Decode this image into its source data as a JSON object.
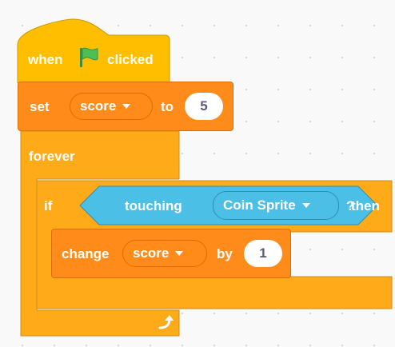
{
  "colors": {
    "events": "#ffbf00",
    "control": "#ffab19",
    "variables": "#ff8c1a",
    "sensing": "#4cbfe6",
    "flag": "#4cbf56"
  },
  "hat_block": {
    "when": "when",
    "icon": "green-flag-icon",
    "clicked": "clicked"
  },
  "set_block": {
    "label": "set",
    "variable": "score",
    "to": "to",
    "value": "5"
  },
  "forever_block": {
    "label": "forever",
    "icon": "loop-arrow-icon"
  },
  "if_block": {
    "label": "if",
    "condition": {
      "label": "touching",
      "target": "Coin Sprite",
      "question": "?"
    },
    "then": "then"
  },
  "change_block": {
    "label": "change",
    "variable": "score",
    "by": "by",
    "value": "1"
  }
}
